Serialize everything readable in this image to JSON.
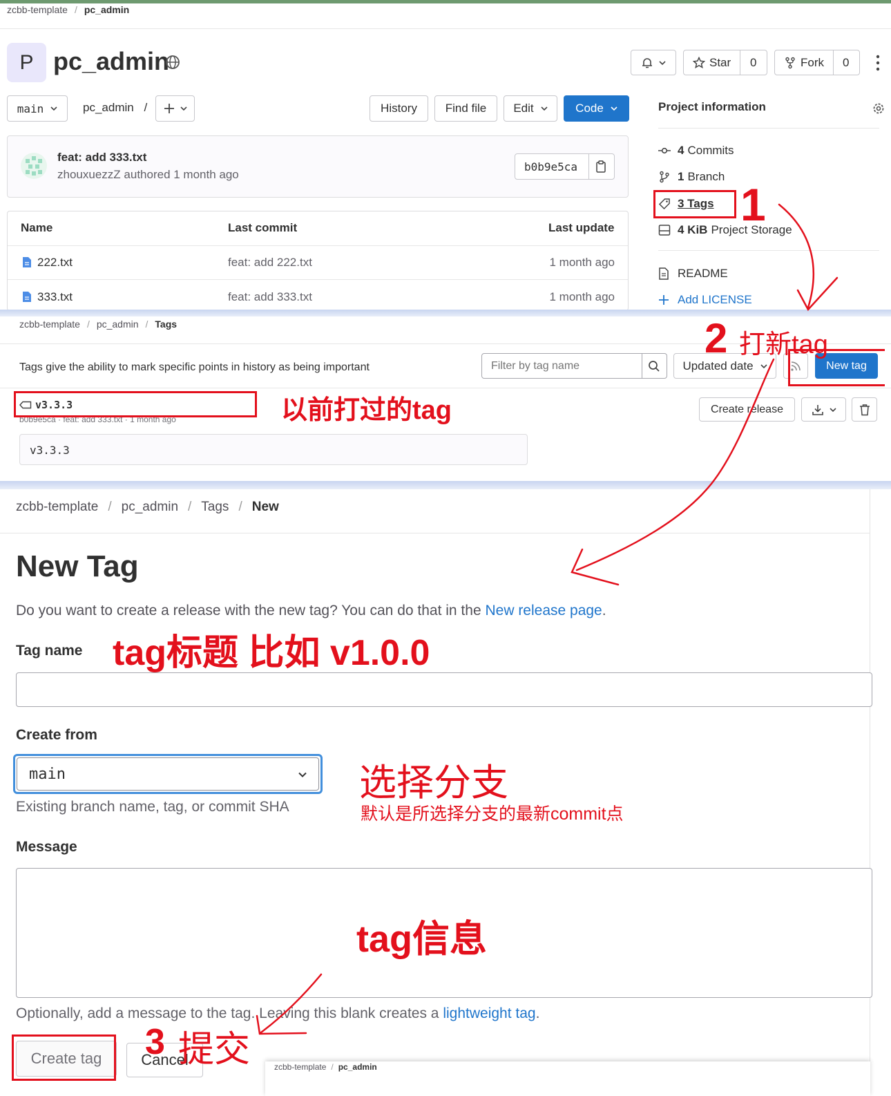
{
  "section1": {
    "breadcrumb": [
      "zcbb-template",
      "pc_admin"
    ],
    "project": {
      "avatar_letter": "P",
      "name": "pc_admin"
    },
    "header_buttons": {
      "star": "Star",
      "star_count": "0",
      "fork": "Fork",
      "fork_count": "0"
    },
    "toolbar": {
      "branch": "main",
      "path": "pc_admin",
      "path_sep": "/",
      "history": "History",
      "find_file": "Find file",
      "edit": "Edit",
      "code": "Code"
    },
    "commit": {
      "title": "feat: add 333.txt",
      "author": "zhouxuezzZ",
      "meta": "authored 1 month ago",
      "sha": "b0b9e5ca"
    },
    "file_table": {
      "headers": [
        "Name",
        "Last commit",
        "Last update"
      ],
      "rows": [
        {
          "name": "222.txt",
          "commit": "feat: add 222.txt",
          "updated": "1 month ago"
        },
        {
          "name": "333.txt",
          "commit": "feat: add 333.txt",
          "updated": "1 month ago"
        }
      ]
    },
    "project_info": {
      "title": "Project information",
      "commits_count": "4",
      "commits_label": "Commits",
      "branch_count": "1",
      "branch_label": "Branch",
      "tags": "3 Tags",
      "storage_size": "4 KiB",
      "storage_label": "Project Storage",
      "readme": "README",
      "add_license": "Add LICENSE"
    }
  },
  "section2": {
    "breadcrumb": [
      "zcbb-template",
      "pc_admin",
      "Tags"
    ],
    "description": "Tags give the ability to mark specific points in history as being important",
    "filter_placeholder": "Filter by tag name",
    "sort": "Updated date",
    "new_tag": "New tag",
    "tag": {
      "name": "v3.3.3",
      "meta": "b0b9e5ca · feat: add 333.txt · 1 month ago",
      "message": "v3.3.3"
    },
    "create_release": "Create release"
  },
  "section3": {
    "breadcrumb": [
      "zcbb-template",
      "pc_admin",
      "Tags",
      "New"
    ],
    "title": "New Tag",
    "intro": "Do you want to create a release with the new tag? You can do that in the",
    "intro_link": "New release page",
    "intro_end": ".",
    "tag_name_label": "Tag name",
    "create_from_label": "Create from",
    "create_from_value": "main",
    "create_from_help": "Existing branch name, tag, or commit SHA",
    "message_label": "Message",
    "message_help": "Optionally, add a message to the tag. Leaving this blank creates a",
    "message_help_link": "lightweight tag",
    "message_help_end": ".",
    "create_tag": "Create tag",
    "cancel": "Cancel"
  },
  "footer_crumb": [
    "zcbb-template",
    "pc_admin"
  ],
  "annotations": {
    "step1": "1",
    "step2": "2",
    "step2_text": "打新tag",
    "old_tag": "以前打过的tag",
    "tag_title": "tag标题 比如 v1.0.0",
    "choose_branch": "选择分支",
    "default_commit": "默认是所选择分支的最新commit点",
    "tag_info": "tag信息",
    "step3": "3",
    "step3_text": "提交"
  },
  "colors": {
    "accent": "#1f75cb",
    "annotation": "#e3101c",
    "top_bar": "#6e9a70"
  }
}
